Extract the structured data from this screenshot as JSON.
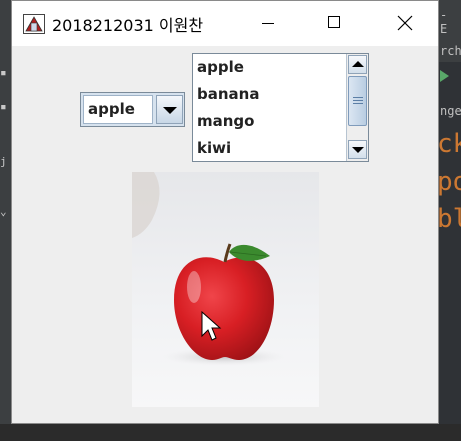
{
  "window": {
    "title": "2018212031 이원찬",
    "minimize_label": "minimize",
    "maximize_label": "maximize",
    "close_label": "close"
  },
  "combo": {
    "selected": "apple"
  },
  "list": {
    "items": [
      "apple",
      "banana",
      "mango",
      "kiwi"
    ]
  },
  "image": {
    "subject": "apple"
  },
  "background_ide": {
    "text_rows": [
      "- E",
      "rch",
      "nge"
    ],
    "code_rows": [
      "ck",
      "po",
      "bl"
    ]
  },
  "colors": {
    "window_bg": "#eeeeee",
    "titlebar_bg": "#ffffff",
    "apple_red": "#d81f24",
    "ide_keyword": "#cc7832"
  }
}
